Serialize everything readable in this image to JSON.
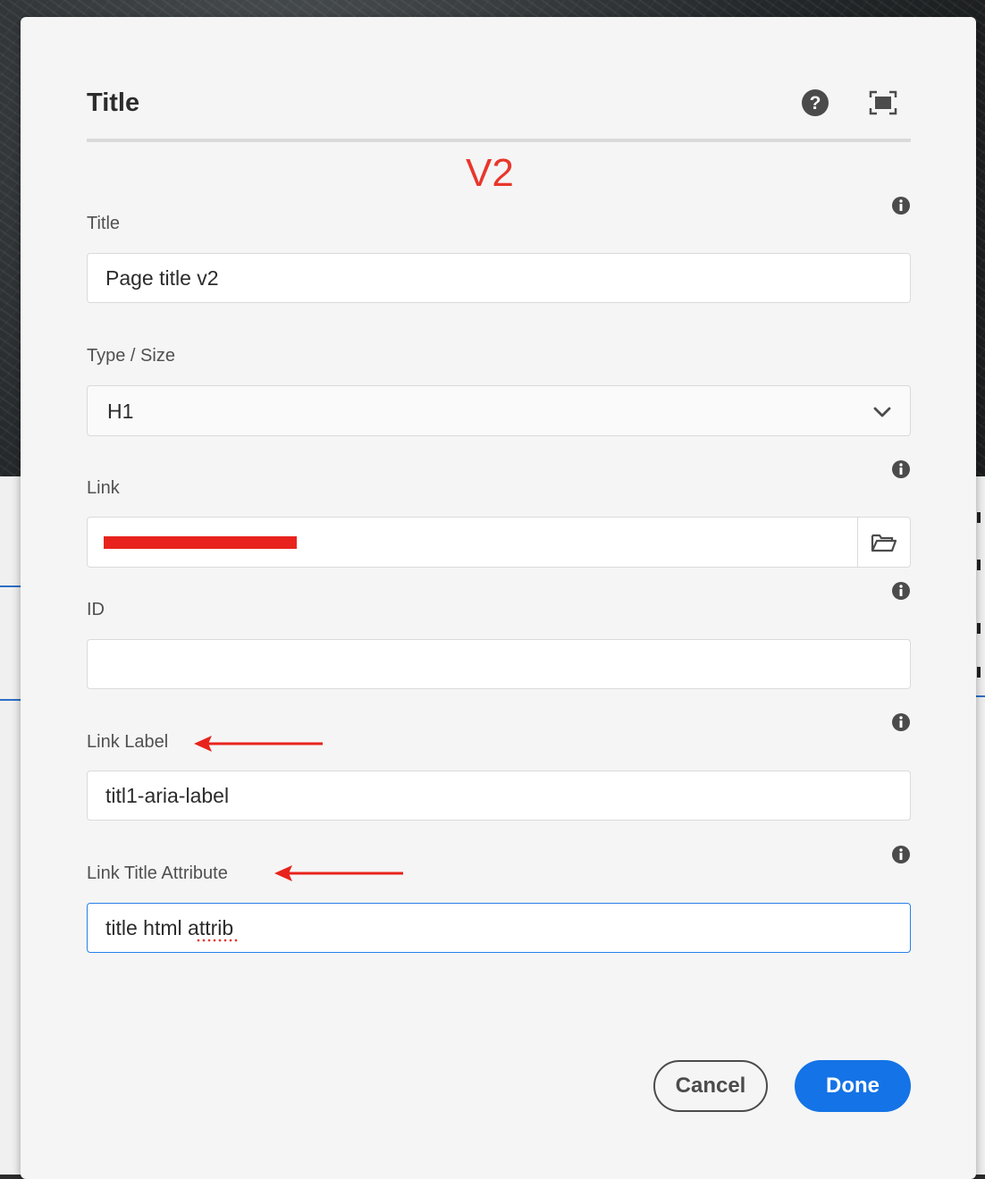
{
  "dialog": {
    "title": "Title",
    "help_icon": "help-circle-icon",
    "fullscreen_icon": "fullscreen-icon"
  },
  "annotation": {
    "version_label": "V2",
    "arrow_color": "#e8372c"
  },
  "fields": {
    "title": {
      "label": "Title",
      "value": "Page title v2"
    },
    "type_size": {
      "label": "Type / Size",
      "selected": "H1"
    },
    "link": {
      "label": "Link",
      "value": ""
    },
    "id": {
      "label": "ID",
      "value": ""
    },
    "link_label": {
      "label": "Link Label",
      "value": "titl1-aria-label"
    },
    "link_title_attribute": {
      "label": "Link Title Attribute",
      "value": "title html attrib"
    }
  },
  "footer": {
    "cancel_label": "Cancel",
    "done_label": "Done"
  },
  "colors": {
    "accent": "#1473e6",
    "focus_border": "#2680eb",
    "annotation_red": "#e8372c"
  }
}
